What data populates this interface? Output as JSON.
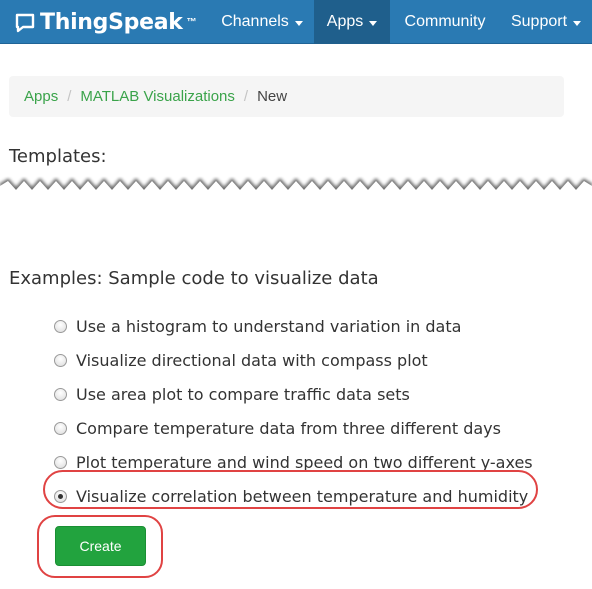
{
  "navbar": {
    "brand": "ThingSpeak",
    "trademark": "™",
    "items": [
      {
        "label": "Channels",
        "has_caret": true,
        "active": false
      },
      {
        "label": "Apps",
        "has_caret": true,
        "active": true
      },
      {
        "label": "Community",
        "has_caret": false,
        "active": false
      },
      {
        "label": "Support",
        "has_caret": true,
        "active": false
      }
    ],
    "colors": {
      "background": "#2a7ab3",
      "active_background": "#1f5f8c"
    }
  },
  "breadcrumb": {
    "items": [
      {
        "label": "Apps",
        "link": true
      },
      {
        "label": "MATLAB Visualizations",
        "link": true
      },
      {
        "label": "New",
        "link": false
      }
    ],
    "separator": "/"
  },
  "templates": {
    "heading": "Templates:"
  },
  "examples": {
    "heading": "Examples: Sample code to visualize data",
    "options": [
      {
        "label": "Use a histogram to understand variation in data",
        "checked": false
      },
      {
        "label": "Visualize directional data with compass plot",
        "checked": false
      },
      {
        "label": "Use area plot to compare traffic data sets",
        "checked": false
      },
      {
        "label": "Compare temperature data from three different days",
        "checked": false
      },
      {
        "label": "Plot temperature and wind speed on two different y-axes",
        "checked": false
      },
      {
        "label": "Visualize correlation between temperature and humidity",
        "checked": true
      }
    ]
  },
  "actions": {
    "create_label": "Create",
    "create_color": "#22a33e"
  },
  "annotations": {
    "highlight_color": "#e04343"
  }
}
